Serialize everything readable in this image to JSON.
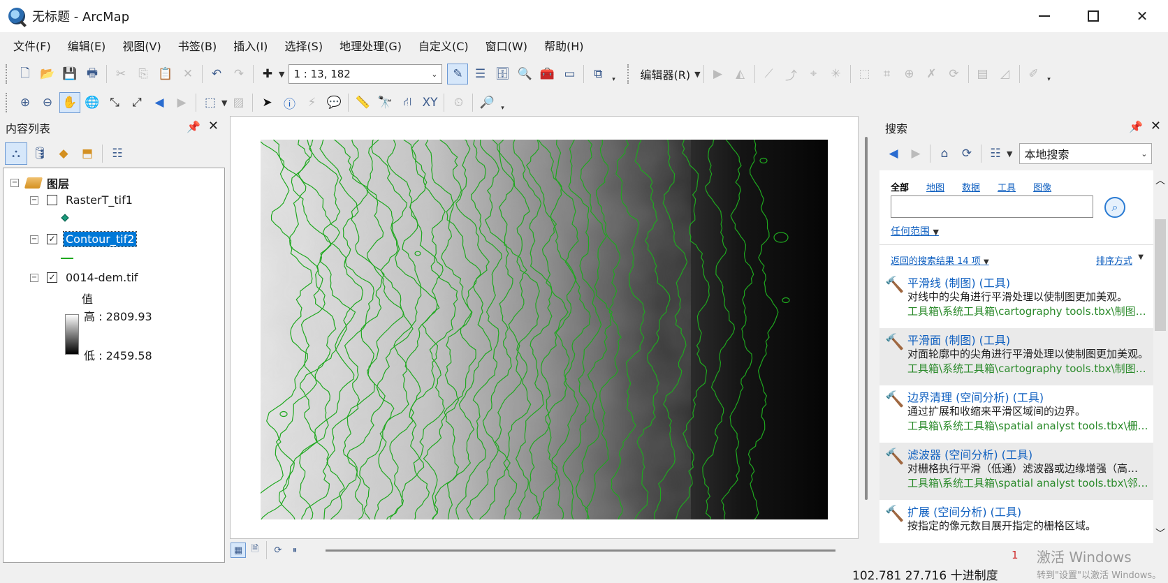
{
  "window": {
    "title": "无标题 - ArcMap"
  },
  "menu": [
    "文件(F)",
    "编辑(E)",
    "视图(V)",
    "书签(B)",
    "插入(I)",
    "选择(S)",
    "地理处理(G)",
    "自定义(C)",
    "窗口(W)",
    "帮助(H)"
  ],
  "toolbar": {
    "scale": "1 : 13, 182",
    "editor_label": "编辑器(R)"
  },
  "toc": {
    "title": "内容列表",
    "root_label": "图层",
    "layers": [
      {
        "name": "RasterT_tif1",
        "checked": false
      },
      {
        "name": "Contour_tif2",
        "checked": true,
        "selected": true
      },
      {
        "name": "0014-dem.tif",
        "checked": true
      }
    ],
    "legend": {
      "heading": "值",
      "high": "高 : 2809.93",
      "low": "低 : 2459.58"
    }
  },
  "search": {
    "title": "搜索",
    "scope_dropdown": "本地搜索",
    "tabs": [
      "全部",
      "地图",
      "数据",
      "工具",
      "图像"
    ],
    "active_tab": "全部",
    "input_value": "",
    "range_label": "任何范围",
    "results_count": "返回的搜索结果 14 项",
    "sort_label": "排序方式",
    "results": [
      {
        "title": "平滑线 (制图) (工具)",
        "desc": "对线中的尖角进行平滑处理以使制图更加美观。",
        "path": "工具箱\\系统工具箱\\cartography tools.tbx\\制图综合"
      },
      {
        "title": "平滑面 (制图) (工具)",
        "desc": "对面轮廓中的尖角进行平滑处理以使制图更加美观。",
        "path": "工具箱\\系统工具箱\\cartography tools.tbx\\制图综合"
      },
      {
        "title": "边界清理 (空间分析) (工具)",
        "desc": "通过扩展和收缩来平滑区域间的边界。",
        "path": "工具箱\\系统工具箱\\spatial analyst tools.tbx\\栅格综合"
      },
      {
        "title": "滤波器 (空间分析) (工具)",
        "desc": "对栅格执行平滑（低通）滤波器或边缘增强（高通）滤波器。",
        "path": "工具箱\\系统工具箱\\spatial analyst tools.tbx\\邻域分析"
      },
      {
        "title": "扩展 (空间分析) (工具)",
        "desc": "按指定的像元数目展开指定的栅格区域。",
        "path": ""
      }
    ]
  },
  "status": {
    "coords": "102.781  27.716 十进制度",
    "badge": "1",
    "activation_title": "激活 Windows",
    "activation_hint": "转到\"设置\"以激活 Windows。"
  },
  "colors": {
    "contour": "#1fa81f",
    "selection": "#0078d7",
    "link": "#1060c0",
    "path": "#2a8a2a"
  }
}
